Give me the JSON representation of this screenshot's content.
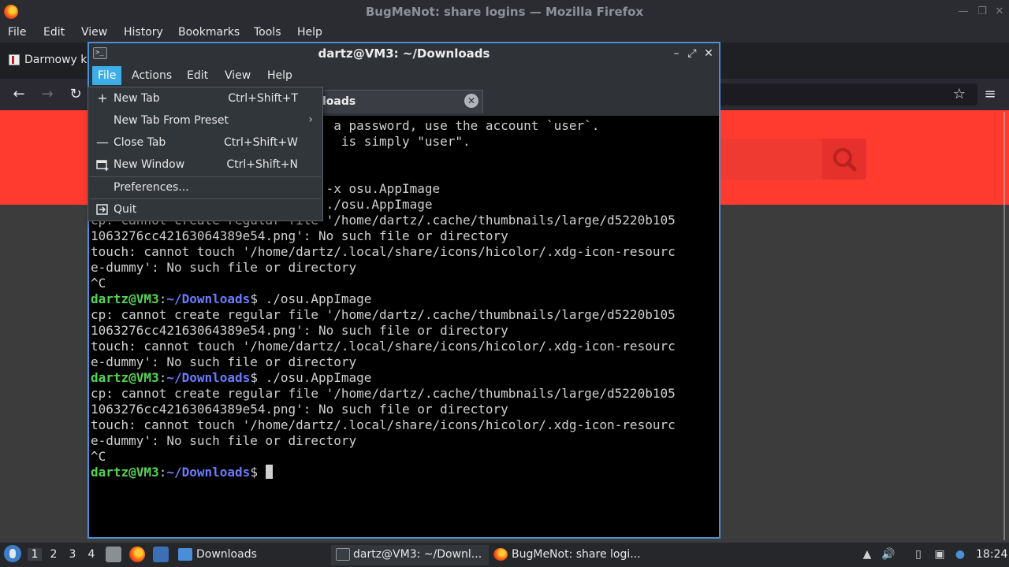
{
  "firefox": {
    "title": "BugMeNot: share logins — Mozilla Firefox",
    "menu": [
      "File",
      "Edit",
      "View",
      "History",
      "Bookmarks",
      "Tools",
      "Help"
    ],
    "tab_label": "Darmowy ka",
    "icons": {
      "back": "back-arrow-icon",
      "forward": "forward-arrow-icon",
      "reload": "reload-icon",
      "bookmark": "star-icon",
      "menu": "hamburger-icon",
      "search": "search-icon"
    }
  },
  "terminal": {
    "title": "dartz@VM3: ~/Downloads",
    "menu": [
      "File",
      "Actions",
      "Edit",
      "View",
      "Help"
    ],
    "tab_label": "loads",
    "lines": [
      {
        "t": "                                a password, use the account `user`."
      },
      {
        "t": "                                 is simply \"user\"."
      },
      {
        "t": ""
      },
      {
        "t": ""
      },
      {
        "t": "                               -x osu.AppImage"
      },
      {
        "t": "                               ./osu.AppImage"
      },
      {
        "t": "cp: cannot create regular file '/home/dartz/.cache/thumbnails/large/d5220b105"
      },
      {
        "t": "1063276cc42163064389e54.png': No such file or directory"
      },
      {
        "t": "touch: cannot touch '/home/dartz/.local/share/icons/hicolor/.xdg-icon-resourc"
      },
      {
        "t": "e-dummy': No such file or directory"
      },
      {
        "t": "^C"
      },
      {
        "user": "dartz@VM3",
        "sep": ":",
        "path": "~/Downloads",
        "cmd": "$ ./osu.AppImage"
      },
      {
        "t": "cp: cannot create regular file '/home/dartz/.cache/thumbnails/large/d5220b105"
      },
      {
        "t": "1063276cc42163064389e54.png': No such file or directory"
      },
      {
        "t": "touch: cannot touch '/home/dartz/.local/share/icons/hicolor/.xdg-icon-resourc"
      },
      {
        "t": "e-dummy': No such file or directory"
      },
      {
        "user": "dartz@VM3",
        "sep": ":",
        "path": "~/Downloads",
        "cmd": "$ ./osu.AppImage"
      },
      {
        "t": "cp: cannot create regular file '/home/dartz/.cache/thumbnails/large/d5220b105"
      },
      {
        "t": "1063276cc42163064389e54.png': No such file or directory"
      },
      {
        "t": "touch: cannot touch '/home/dartz/.local/share/icons/hicolor/.xdg-icon-resourc"
      },
      {
        "t": "e-dummy': No such file or directory"
      },
      {
        "t": "^C"
      },
      {
        "user": "dartz@VM3",
        "sep": ":",
        "path": "~/Downloads",
        "cmd": "$ ",
        "cursor": true
      }
    ]
  },
  "file_menu": {
    "new_tab": {
      "label": "New Tab",
      "shortcut": "Ctrl+Shift+T"
    },
    "new_tab_preset": {
      "label": "New Tab From Preset"
    },
    "close_tab": {
      "label": "Close Tab",
      "shortcut": "Ctrl+Shift+W"
    },
    "new_window": {
      "label": "New Window",
      "shortcut": "Ctrl+Shift+N"
    },
    "preferences": {
      "label": "Preferences..."
    },
    "quit": {
      "label": "Quit"
    }
  },
  "taskbar": {
    "workspaces": [
      "1",
      "2",
      "3",
      "4"
    ],
    "tasks": [
      {
        "label": "Downloads"
      },
      {
        "label": "dartz@VM3: ~/Downl..."
      },
      {
        "label": "BugMeNot: share logi..."
      }
    ],
    "clock": "18:24"
  },
  "colors": {
    "accent": "#3daee9",
    "prompt_user": "#54d354",
    "prompt_path": "#6a7cff",
    "page_red": "#ff3b30"
  }
}
